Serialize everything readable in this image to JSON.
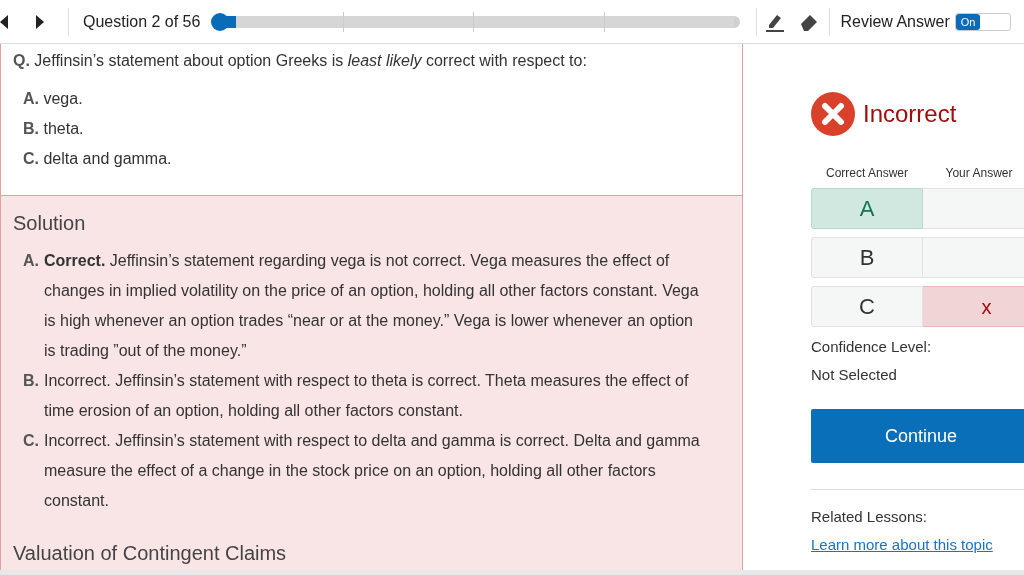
{
  "header": {
    "question_label": "Question 2 of 56",
    "progress": {
      "level": 0.015
    },
    "review_label": "Review Answer",
    "toggle": {
      "label": "On",
      "on": true
    }
  },
  "question": {
    "label": "Q.",
    "text": "Jeffinsin’s statement about option Greeks is *least likely* correct with respect to:"
  },
  "options": [
    {
      "letter": "A.",
      "text": "vega."
    },
    {
      "letter": "B.",
      "text": "theta."
    },
    {
      "letter": "C.",
      "text": "delta and gamma."
    }
  ],
  "solution": {
    "title": "Solution",
    "items": [
      {
        "letter": "A.",
        "text": "**Correct.** Jeffinsin’s statement regarding vega is not correct. Vega measures the effect of changes in implied volatility on the price of an option, holding all other factors constant. Vega is high whenever an option trades “near or at the money.” Vega is lower whenever an option is trading ”out of the money.”"
      },
      {
        "letter": "B.",
        "text": "Incorrect. Jeffinsin’s statement with respect to theta is correct. Theta measures the effect of time erosion of an option, holding all other factors constant."
      },
      {
        "letter": "C.",
        "text": "Incorrect. Jeffinsin’s statement with respect to delta and gamma is correct. Delta and gamma measure the effect of a change in the stock price on an option, holding all other factors constant."
      }
    ],
    "next_heading": "Valuation of Contingent Claims"
  },
  "result": {
    "label": "Incorrect"
  },
  "answers": {
    "columns": [
      "Correct Answer",
      "Your Answer"
    ],
    "rows": [
      {
        "letter": "A",
        "correct": true,
        "chosen": false
      },
      {
        "letter": "B",
        "correct": false,
        "chosen": false
      },
      {
        "letter": "C",
        "correct": false,
        "chosen": true,
        "mark": "x"
      }
    ]
  },
  "confidence": {
    "label": "Confidence Level:",
    "value": "Not Selected"
  },
  "continue_button": "Continue",
  "related": {
    "label": "Related Lessons:",
    "link": "Learn more about this topic"
  }
}
